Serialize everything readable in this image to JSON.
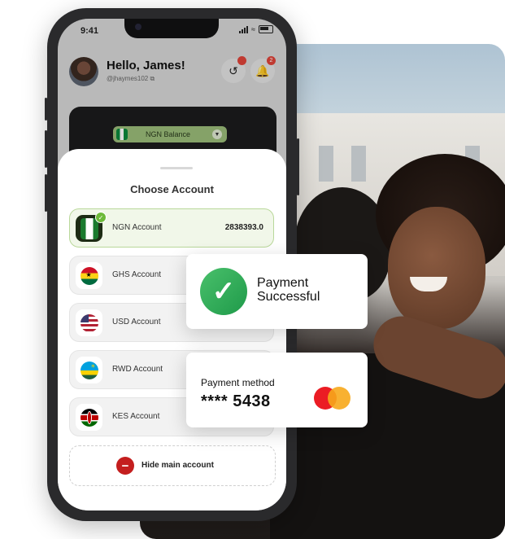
{
  "status_bar": {
    "time": "9:41"
  },
  "header": {
    "greeting": "Hello, James!",
    "handle": "@jhaymes102",
    "notification_count": "2"
  },
  "balance_card": {
    "label": "NGN Balance"
  },
  "sheet": {
    "title": "Choose Account",
    "accounts": [
      {
        "label": "NGN Account",
        "amount": "2838393.0",
        "selected": true
      },
      {
        "label": "GHS Account",
        "amount": ""
      },
      {
        "label": "USD Account",
        "amount": ""
      },
      {
        "label": "RWD Account",
        "amount": ""
      },
      {
        "label": "KES Account",
        "amount": ""
      }
    ],
    "hide_label": "Hide main account"
  },
  "success_card": {
    "text": "Payment Successful"
  },
  "method_card": {
    "label": "Payment method",
    "number": "**** 5438",
    "brand_icon": "mastercard-icon"
  },
  "colors": {
    "accent_green": "#6dba3a",
    "success_green": "#2fae57",
    "danger_red": "#c41e1e"
  }
}
